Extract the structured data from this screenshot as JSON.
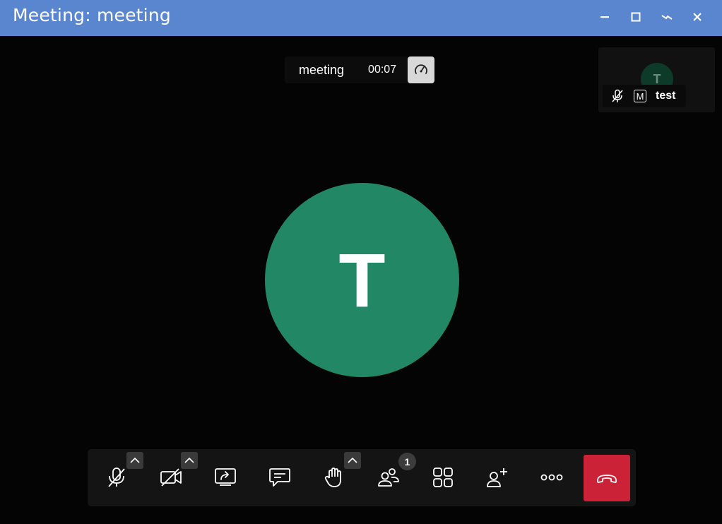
{
  "window": {
    "title": "Meeting: meeting",
    "controls": [
      "minimize-icon",
      "maximize-icon",
      "restore-icon",
      "close-icon"
    ]
  },
  "meeting_info": {
    "name": "meeting",
    "timer": "00:07",
    "speed_icon": "speedometer-icon"
  },
  "self_view": {
    "initial": "T",
    "name": "test",
    "moderator_badge": "M",
    "muted": true
  },
  "main_participant": {
    "initial": "T",
    "avatar_color": "#228764"
  },
  "toolbar": {
    "buttons": [
      {
        "name": "microphone",
        "icon": "mic-muted-icon",
        "has_options": true
      },
      {
        "name": "camera",
        "icon": "camera-off-icon",
        "has_options": true
      },
      {
        "name": "screen-share",
        "icon": "screen-share-icon",
        "has_options": false
      },
      {
        "name": "chat",
        "icon": "chat-icon",
        "has_options": false
      },
      {
        "name": "raise-hand",
        "icon": "hand-icon",
        "has_options": true
      },
      {
        "name": "participants",
        "icon": "participants-icon",
        "has_options": false
      },
      {
        "name": "tile-view",
        "icon": "tile-view-icon",
        "has_options": false
      },
      {
        "name": "invite",
        "icon": "add-person-icon",
        "has_options": false
      },
      {
        "name": "more",
        "icon": "more-icon",
        "has_options": false
      },
      {
        "name": "hangup",
        "icon": "hangup-icon",
        "has_options": false
      }
    ],
    "participants_count": "1",
    "hangup_color": "#cc2237"
  },
  "colors": {
    "titlebar": "#5a86d0",
    "background": "#040404",
    "toolbar": "#141414"
  }
}
